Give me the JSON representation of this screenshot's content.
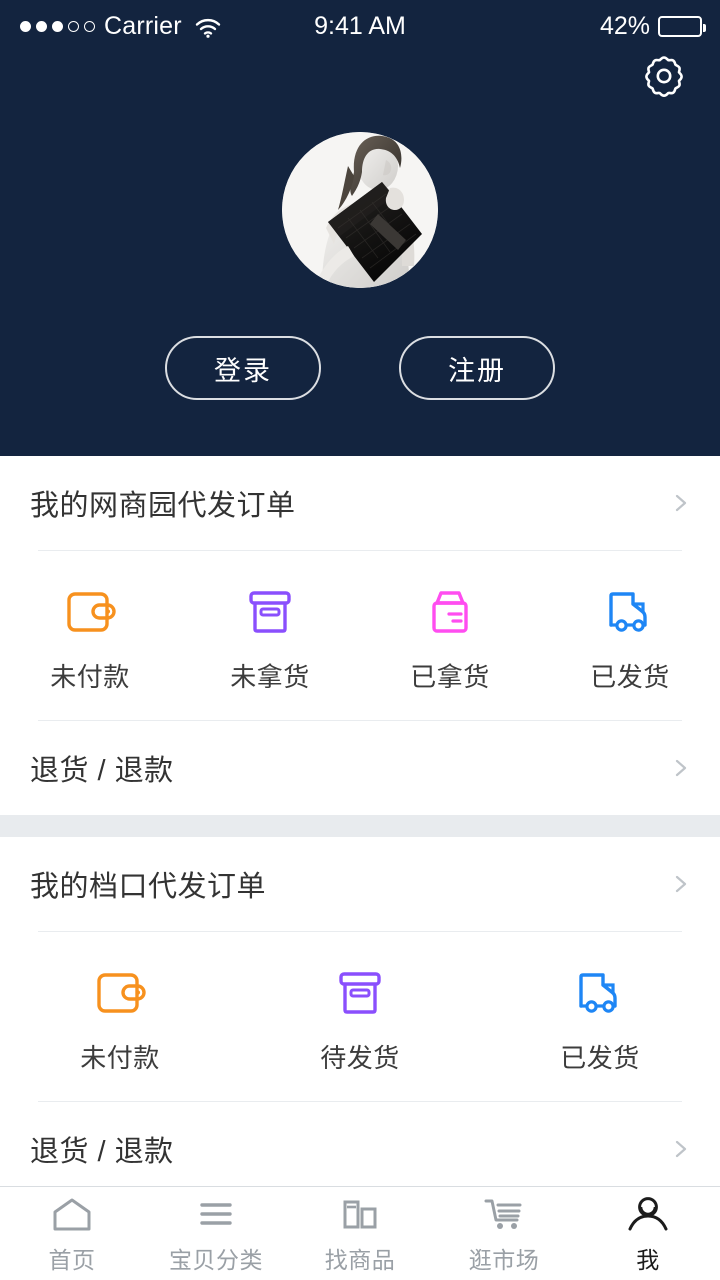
{
  "status_bar": {
    "carrier": "Carrier",
    "signal_dots_filled": 3,
    "signal_dots_total": 5,
    "wifi_icon": "wifi-icon",
    "time": "9:41 AM",
    "battery_percent": "42%",
    "battery_level": 42
  },
  "header": {
    "background_color": "#13243f",
    "settings_icon": "gear-icon",
    "avatar": {
      "name": "user-avatar",
      "description": "black and white fashion photo of a model holding a dark textured clutch bag"
    },
    "login_label": "登录",
    "register_label": "注册"
  },
  "sections": [
    {
      "title": "我的网商园代发订单",
      "chevron_icon": "chevron-right-icon",
      "statuses": [
        {
          "label": "未付款",
          "icon": "wallet-icon",
          "color": "#f7911e"
        },
        {
          "label": "未拿货",
          "icon": "archive-box-icon",
          "color": "#8a4ffd"
        },
        {
          "label": "已拿货",
          "icon": "package-box-icon",
          "color": "#ff4df0"
        },
        {
          "label": "已发货",
          "icon": "delivery-truck-icon",
          "color": "#1e86f5"
        }
      ],
      "footer_label": "退货 / 退款",
      "footer_chevron_icon": "chevron-right-icon"
    },
    {
      "title": "我的档口代发订单",
      "chevron_icon": "chevron-right-icon",
      "statuses": [
        {
          "label": "未付款",
          "icon": "wallet-icon",
          "color": "#f7911e"
        },
        {
          "label": "待发货",
          "icon": "archive-box-icon",
          "color": "#8a4ffd"
        },
        {
          "label": "已发货",
          "icon": "delivery-truck-icon",
          "color": "#1e86f5"
        }
      ],
      "footer_label": "退货 / 退款",
      "footer_chevron_icon": "chevron-right-icon"
    }
  ],
  "tabbar": {
    "items": [
      {
        "label": "首页",
        "icon": "home-icon",
        "active": false
      },
      {
        "label": "宝贝分类",
        "icon": "list-lines-icon",
        "active": false
      },
      {
        "label": "找商品",
        "icon": "grid-blocks-icon",
        "active": false
      },
      {
        "label": "逛市场",
        "icon": "shopping-cart-icon",
        "active": false
      },
      {
        "label": "我",
        "icon": "person-icon",
        "active": true
      }
    ]
  },
  "colors": {
    "navy": "#13243f",
    "band": "#e8ebee",
    "divider": "#e9ecef",
    "tab_inactive": "#9aa0a6",
    "tab_active": "#1c1c1c"
  }
}
